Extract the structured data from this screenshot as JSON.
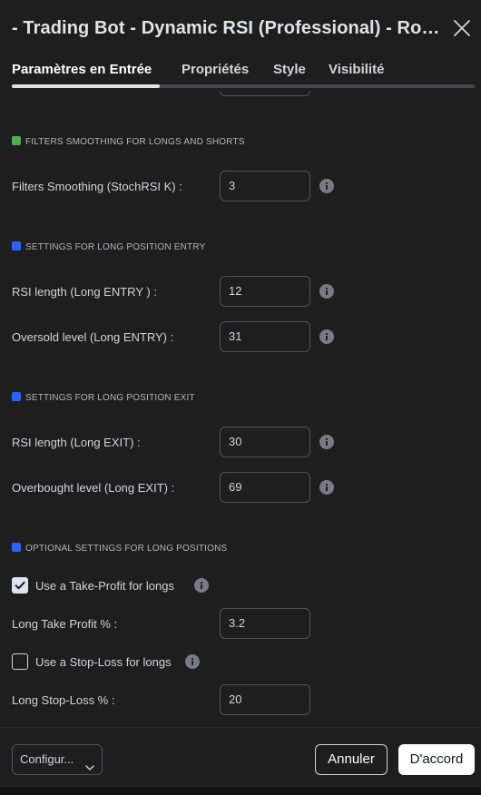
{
  "header": {
    "title": "- Trading Bot - Dynamic RSI (Professional) - Robotrader",
    "close_icon": "close-icon"
  },
  "tabs": [
    {
      "label": "Paramètres en Entrée",
      "active": true
    },
    {
      "label": "Propriétés",
      "active": false
    },
    {
      "label": "Style",
      "active": false
    },
    {
      "label": "Visibilité",
      "active": false
    }
  ],
  "colors": {
    "green_marker": "#4caf50",
    "blue_marker": "#2962ff"
  },
  "sections": {
    "filters": "FILTERS SMOOTHING FOR LONGS AND SHORTS",
    "long_entry": "SETTINGS FOR LONG POSITION ENTRY",
    "long_exit": "SETTINGS FOR LONG POSITION EXIT",
    "optional": "OPTIONAL SETTINGS FOR LONG POSITIONS"
  },
  "fields": {
    "filters_smoothing": {
      "label": "Filters Smoothing (StochRSI K) :",
      "value": "3"
    },
    "rsi_long_entry": {
      "label": "RSI length (Long ENTRY ) :",
      "value": "12"
    },
    "oversold_long_entry": {
      "label": "Oversold level (Long ENTRY) :",
      "value": "31"
    },
    "rsi_long_exit": {
      "label": "RSI length (Long EXIT) :",
      "value": "30"
    },
    "overbought_long_exit": {
      "label": "Overbought level (Long EXIT) :",
      "value": "69"
    },
    "long_take_profit": {
      "label": "Long Take Profit % :",
      "value": "3.2"
    },
    "long_stop_loss": {
      "label": "Long Stop-Loss % :",
      "value": "20"
    }
  },
  "checkboxes": {
    "take_profit": {
      "label": "Use a Take-Profit for longs",
      "checked": true
    },
    "stop_loss": {
      "label": "Use a Stop-Loss for longs",
      "checked": false
    }
  },
  "footer": {
    "preset_label": "Configur...",
    "cancel_label": "Annuler",
    "ok_label": "D'accord"
  }
}
